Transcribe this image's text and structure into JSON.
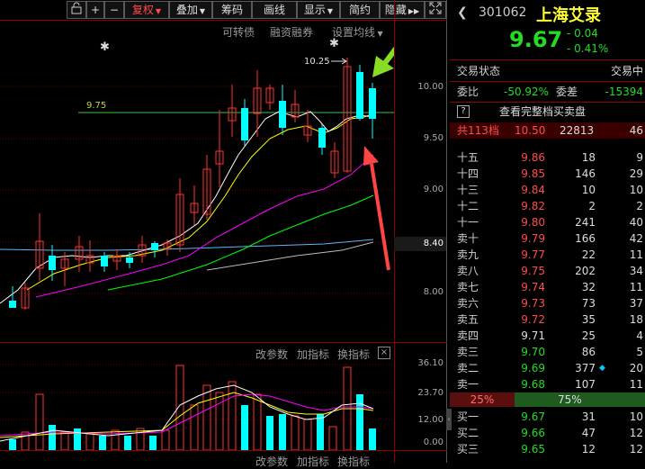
{
  "toolbar": {
    "fuquan": "复权",
    "diejia": "叠加",
    "chouma": "筹码",
    "huaxian": "画线",
    "xianshi": "显示",
    "jianyue": "简约",
    "yincang": "隐藏",
    "plus": "+",
    "minus": "−"
  },
  "chart": {
    "menu_kezhuanzhai": "可转债",
    "menu_rongzi": "融资融券",
    "menu_junxian": "设置均线",
    "price_ticks": [
      "10.00",
      "9.50",
      "9.00",
      "8.40",
      "8.00"
    ],
    "level_label": "9.75",
    "high_label": "10.25",
    "colors": {
      "up": "#ff3333",
      "down": "#00ffff",
      "ma5": "#ffffff",
      "ma10": "#ffff00",
      "ma20": "#ff00ff",
      "ma30": "#00ff00",
      "ma60": "#5fb4ff",
      "arrow_red": "#ff4444",
      "arrow_green": "#88dd22"
    }
  },
  "indicator": {
    "gai_canshu": "改参数",
    "jia_zhibiao": "加指标",
    "huan_zhibiao": "换指标",
    "ticks": [
      "36.10",
      "23.70",
      "12.00",
      "0.00"
    ]
  },
  "quote": {
    "code": "301062",
    "name": "上海艾录",
    "price": "9.67",
    "change": "- 0.04",
    "change_pct": "- 0.41%",
    "status_label": "交易状态",
    "status_value": "交易中",
    "weibi_label": "委比",
    "weibi_value": "-50.92%",
    "weicha_label": "委差",
    "weicha_value": "-15394",
    "full_book": "查看完整档买卖盘",
    "total_label": "共113档",
    "total_price": "10.50",
    "total_vol": "22813",
    "total_ch": "46",
    "sell_levels": [
      {
        "label": "十五",
        "price": "9.86",
        "vol": "18",
        "ch": "9"
      },
      {
        "label": "十四",
        "price": "9.85",
        "vol": "146",
        "ch": "29"
      },
      {
        "label": "十三",
        "price": "9.84",
        "vol": "10",
        "ch": "10"
      },
      {
        "label": "十二",
        "price": "9.82",
        "vol": "2",
        "ch": "2"
      },
      {
        "label": "十一",
        "price": "9.80",
        "vol": "241",
        "ch": "40"
      },
      {
        "label": "卖十",
        "price": "9.79",
        "vol": "166",
        "ch": "42"
      },
      {
        "label": "卖九",
        "price": "9.77",
        "vol": "22",
        "ch": "11"
      },
      {
        "label": "卖八",
        "price": "9.75",
        "vol": "202",
        "ch": "34"
      },
      {
        "label": "卖七",
        "price": "9.74",
        "vol": "32",
        "ch": "11"
      },
      {
        "label": "卖六",
        "price": "9.73",
        "vol": "73",
        "ch": "37"
      },
      {
        "label": "卖五",
        "price": "9.72",
        "vol": "35",
        "ch": "18"
      },
      {
        "label": "卖四",
        "price": "9.71",
        "vol": "25",
        "ch": "4"
      },
      {
        "label": "卖三",
        "price": "9.70",
        "vol": "86",
        "ch": "5"
      },
      {
        "label": "卖二",
        "price": "9.69",
        "vol": "377",
        "ch": "20"
      },
      {
        "label": "卖一",
        "price": "9.68",
        "vol": "107",
        "ch": "11"
      }
    ],
    "ratio_sell": "25%",
    "ratio_buy": "75%",
    "buy_levels": [
      {
        "label": "买一",
        "price": "9.67",
        "vol": "31",
        "ch": "10"
      },
      {
        "label": "买二",
        "price": "9.66",
        "vol": "47",
        "ch": "12"
      },
      {
        "label": "买三",
        "price": "9.65",
        "vol": "12",
        "ch": "12"
      }
    ]
  }
}
